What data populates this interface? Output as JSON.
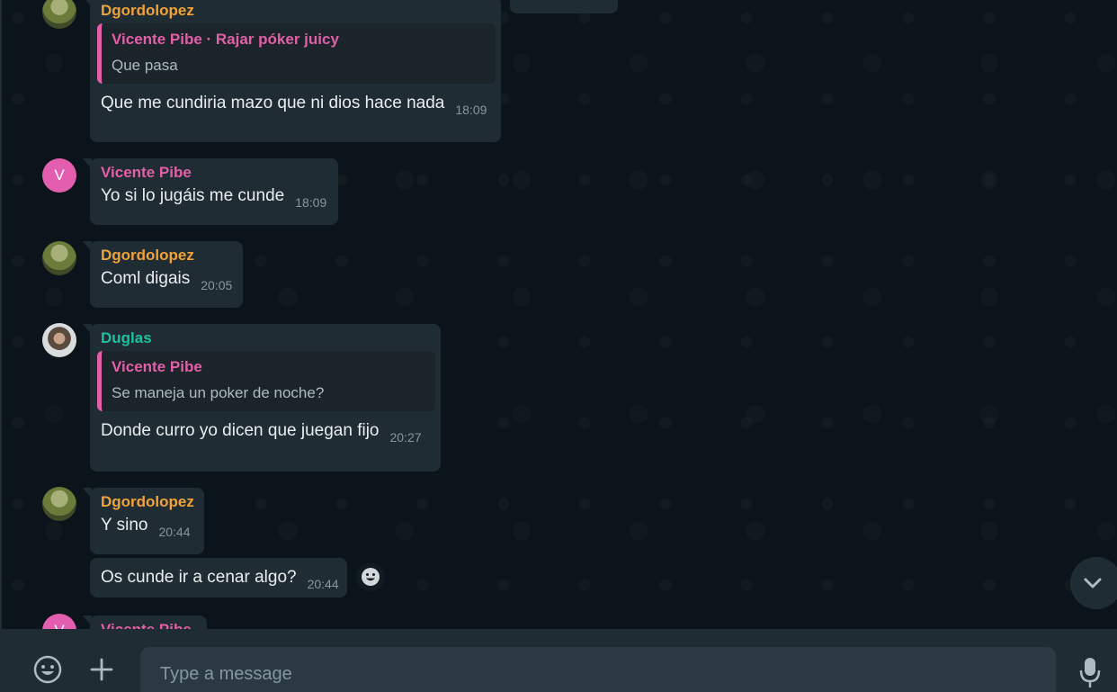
{
  "messages": [
    {
      "sender": "Dgordolopez",
      "quote": {
        "name": "Vicente Pibe · Rajar póker juicy",
        "text": "Que pasa"
      },
      "text": "Que me cundiria mazo que ni dios hace nada",
      "time": "18:09"
    },
    {
      "avatar_initial": "V",
      "sender": "Vicente Pibe",
      "text": "Yo si lo jugáis me cunde",
      "time": "18:09"
    },
    {
      "sender": "Dgordolopez",
      "text": "Coml digais",
      "time": "20:05"
    },
    {
      "sender": "Duglas",
      "quote": {
        "name": "Vicente Pibe",
        "text": "Se maneja un poker de noche?"
      },
      "text": "Donde curro yo dicen que juegan fijo",
      "time": "20:27"
    },
    {
      "sender": "Dgordolopez",
      "text": "Y sino",
      "time": "20:44"
    },
    {
      "text": "Os cunde ir a cenar algo?",
      "time": "20:44"
    },
    {
      "avatar_initial": "V",
      "sender": "Vicente Pibe"
    }
  ],
  "composer": {
    "placeholder": "Type a message"
  },
  "icons": {
    "emoji": "emoji-icon",
    "attach": "plus-icon",
    "mic": "microphone-icon",
    "scroll_down": "chevron-down-icon",
    "react": "emoji-reaction-icon"
  },
  "colors": {
    "background": "#0b141a",
    "bubble": "#202c33",
    "sender_orange": "#f0a33a",
    "sender_pink": "#e25fa9",
    "sender_green": "#1cc29e",
    "timestamp": "#8696a0"
  }
}
